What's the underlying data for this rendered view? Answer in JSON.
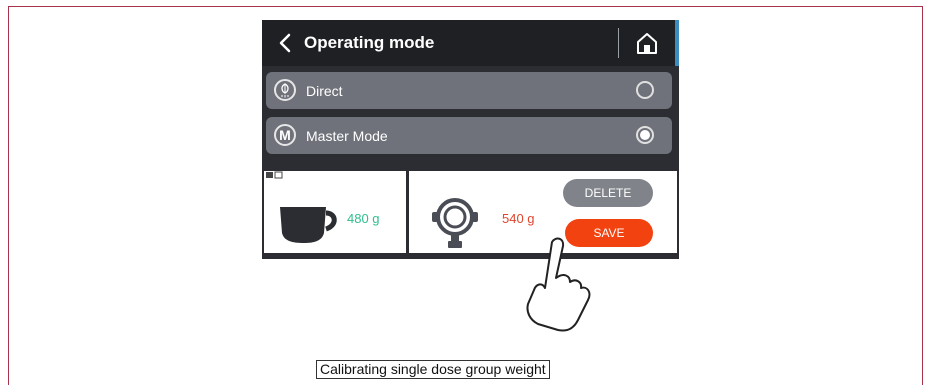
{
  "header": {
    "title": "Operating mode"
  },
  "modes": [
    {
      "label": "Direct",
      "selected": false,
      "icon": "coffee-bean-icon"
    },
    {
      "label": "Master Mode",
      "selected": true,
      "icon": "m-letter-icon",
      "icon_letter": "M"
    }
  ],
  "panel": {
    "cup_weight": "480 g",
    "group_weight": "540 g",
    "delete_label": "DELETE",
    "save_label": "SAVE"
  },
  "caption": "Calibrating single dose group weight",
  "colors": {
    "header_bg": "#1f2024",
    "row_bg": "#6f727a",
    "green_value": "#2fbf8c",
    "red_value": "#e0452e",
    "save_button": "#f2420f",
    "delete_button": "#80838a",
    "frame_border": "#a7344a"
  }
}
